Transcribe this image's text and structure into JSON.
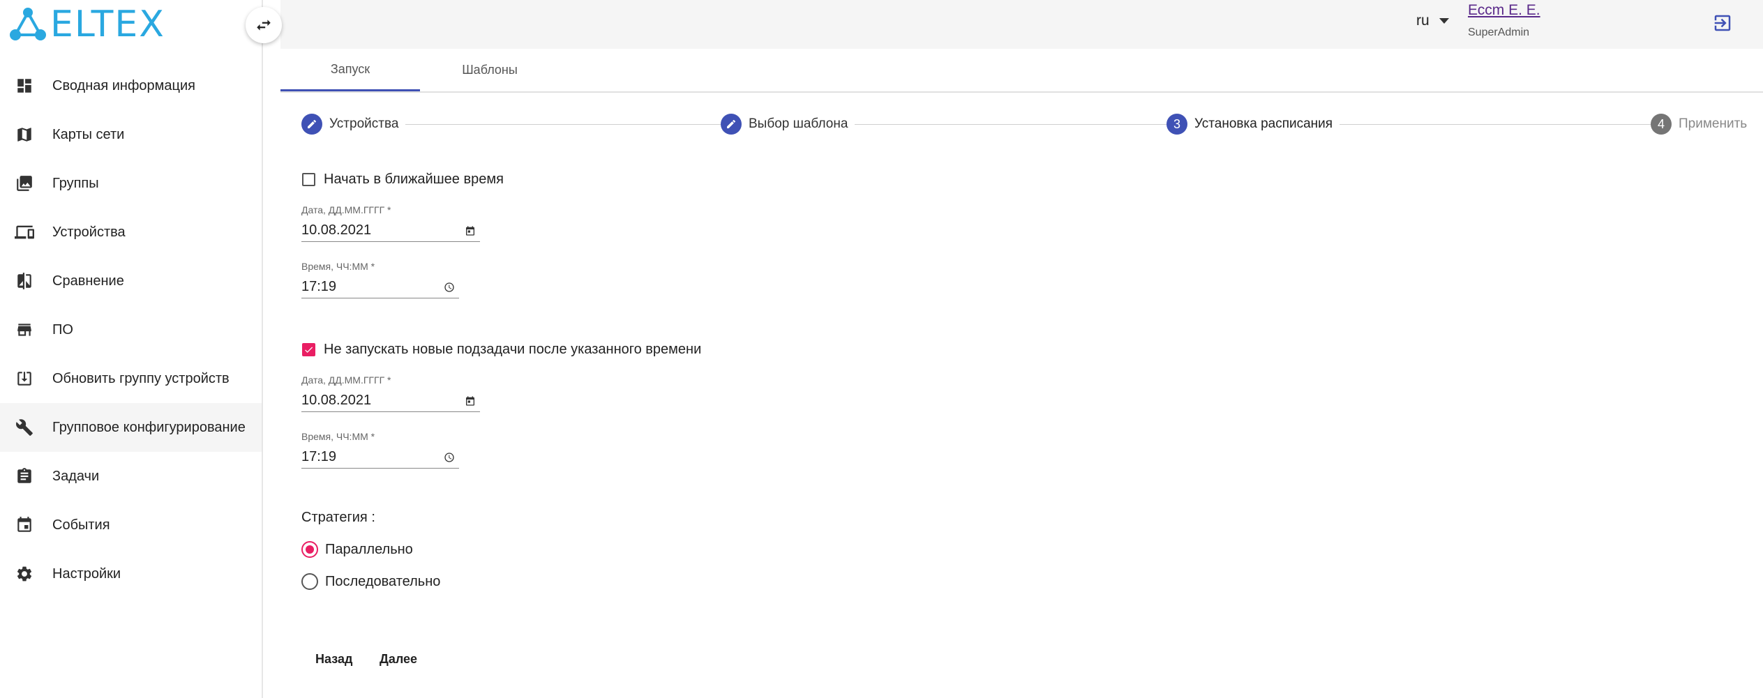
{
  "app": {
    "logo_text": "ELTEX"
  },
  "sidebar": {
    "items": [
      {
        "label": "Сводная информация",
        "icon": "dashboard-icon",
        "active": false
      },
      {
        "label": "Карты сети",
        "icon": "map-icon",
        "active": false
      },
      {
        "label": "Группы",
        "icon": "photo-library-icon",
        "active": false
      },
      {
        "label": "Устройства",
        "icon": "devices-icon",
        "active": false
      },
      {
        "label": "Сравнение",
        "icon": "compare-icon",
        "active": false
      },
      {
        "label": "ПО",
        "icon": "store-icon",
        "active": false
      },
      {
        "label": "Обновить группу устройств",
        "icon": "download-box-icon",
        "active": false
      },
      {
        "label": "Групповое конфигурирование",
        "icon": "wrench-icon",
        "active": true
      },
      {
        "label": "Задачи",
        "icon": "clipboard-icon",
        "active": false
      },
      {
        "label": "События",
        "icon": "calendar-icon",
        "active": false
      },
      {
        "label": "Настройки",
        "icon": "gear-icon",
        "active": false
      }
    ]
  },
  "header": {
    "language": "ru",
    "user_name": "Ессm Е. Е.",
    "user_role": "SuperAdmin"
  },
  "tabs": [
    {
      "label": "Запуск",
      "active": true
    },
    {
      "label": "Шаблоны",
      "active": false
    }
  ],
  "stepper": {
    "steps": [
      {
        "label": "Устройства",
        "marker": "",
        "state": "done"
      },
      {
        "label": "Выбор шаблона",
        "marker": "",
        "state": "done"
      },
      {
        "label": "Установка расписания",
        "marker": "3",
        "state": "active"
      },
      {
        "label": "Применить",
        "marker": "4",
        "state": "pending"
      }
    ]
  },
  "form": {
    "start_now": {
      "label": "Начать в ближайшее время",
      "checked": false
    },
    "start_date": {
      "label": "Дата, ДД.ММ.ГГГГ *",
      "value": "10.08.2021"
    },
    "start_time": {
      "label": "Время, ЧЧ:ММ *",
      "value": "17:19"
    },
    "no_new_subtasks": {
      "label": "Не запускать новые подзадачи после указанного времени",
      "checked": true
    },
    "end_date": {
      "label": "Дата, ДД.ММ.ГГГГ *",
      "value": "10.08.2021"
    },
    "end_time": {
      "label": "Время, ЧЧ:ММ *",
      "value": "17:19"
    },
    "strategy_label": "Стратегия :",
    "strategy_options": [
      {
        "label": "Параллельно",
        "checked": true
      },
      {
        "label": "Последовательно",
        "checked": false
      }
    ]
  },
  "actions": {
    "back": "Назад",
    "next": "Далее"
  },
  "colors": {
    "primary": "#3f51b5",
    "accent": "#e91e63",
    "logo": "#2aa8e0"
  }
}
